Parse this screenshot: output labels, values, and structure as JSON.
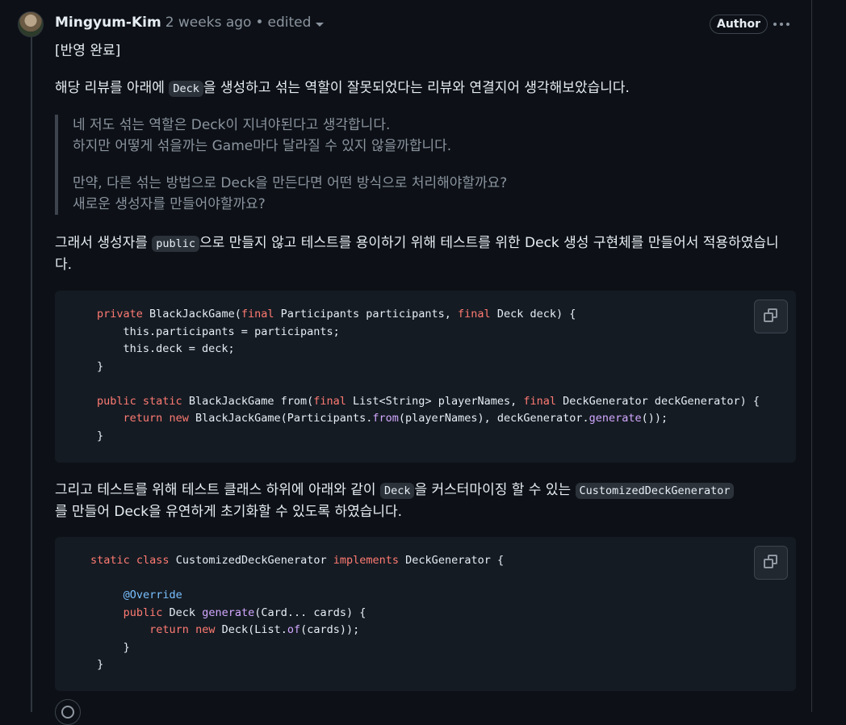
{
  "comment": {
    "author": "Mingyum-Kim",
    "time": "2 weeks ago",
    "separator": "•",
    "edited": "edited",
    "badge": "Author"
  },
  "body": {
    "p1": "[반영 완료]",
    "p2": {
      "before": "해당 리뷰를 아래에 ",
      "code": "Deck",
      "after": "을 생성하고 섞는 역할이 잘못되었다는 리뷰와 연결지어 생각해보았습니다."
    },
    "quote": {
      "line1": "네 저도 섞는 역할은 Deck이 지녀야된다고 생각합니다.",
      "line2": "하지만 어떻게 섞을까는 Game마다 달라질 수 있지 않을까합니다.",
      "line3": "만약, 다른 섞는 방법으로 Deck을 만든다면 어떤 방식으로 처리해야할까요?",
      "line4": "새로운 생성자를 만들어야할까요?"
    },
    "p3": {
      "before": "그래서 생성자를 ",
      "code": "public",
      "after": "으로 만들지 않고 테스트를 용이하기 위해 테스트를 위한 Deck 생성 구현체를 만들어서 적용하였습니다."
    },
    "p4": {
      "before": "그리고 테스트를 위해 테스트 클래스 하위에 아래와 같이 ",
      "code1": "Deck",
      "middle": "을 커스터마이징 할 수 있는 ",
      "code2": "CustomizedDeckGenerator",
      "after": "를 만들어 Deck을 유연하게 초기화할 수 있도록 하였습니다."
    }
  },
  "code_block_1": {
    "l1": {
      "kw1": "private",
      "t1": " BlackJackGame(",
      "kw2": "final",
      "t2": " Participants participants, ",
      "kw3": "final",
      "t3": " Deck deck) {"
    },
    "l2": "    this.participants = participants;",
    "l3": "    this.deck = deck;",
    "l4": "}",
    "l6": {
      "kw1": "public",
      "kw2": "static",
      "t1": " BlackJackGame from(",
      "kw3": "final",
      "t2": " List<String> playerNames, ",
      "kw4": "final",
      "t3": " DeckGenerator deckGenerator) {"
    },
    "l7": {
      "indent": "    ",
      "kw1": "return",
      "kw2": "new",
      "t1": " BlackJackGame(Participants.",
      "fn1": "from",
      "t2": "(playerNames), deckGenerator.",
      "fn2": "generate",
      "t3": "());"
    },
    "l8": "}"
  },
  "code_block_2": {
    "l1": {
      "kw1": "static",
      "kw2": "class",
      "t1": " CustomizedDeckGenerator ",
      "kw3": "implements",
      "t2": " DeckGenerator {"
    },
    "l3": {
      "indent": "     ",
      "ann": "@Override"
    },
    "l4": {
      "indent": "     ",
      "kw1": "public",
      "t1": " Deck ",
      "fn1": "generate",
      "t2": "(Card... cards) {"
    },
    "l5": {
      "indent": "         ",
      "kw1": "return",
      "kw2": "new",
      "t1": " Deck(List.",
      "fn1": "of",
      "t2": "(cards));"
    },
    "l6": "     }",
    "l7": " }"
  },
  "colors": {
    "background": "#0d1117",
    "code_background": "#151b23",
    "keyword": "#ff7b72",
    "function": "#d2a8ff",
    "annotation": "#79c0ff",
    "muted": "#8b949e"
  },
  "icons": [
    "avatar",
    "caret-down-icon",
    "kebab-icon",
    "copy-icon",
    "smiley-icon"
  ]
}
